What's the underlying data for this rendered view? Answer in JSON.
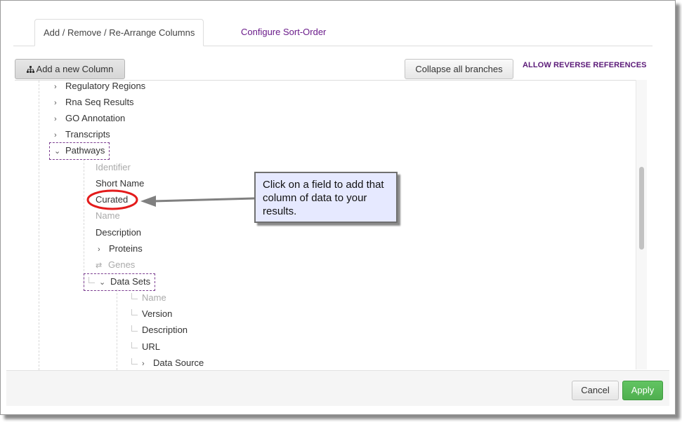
{
  "tabs": [
    {
      "label": "Add / Remove / Re-Arrange Columns",
      "active": true
    },
    {
      "label": "Configure Sort-Order",
      "active": false
    }
  ],
  "toolbar": {
    "add_column_label": "Add a new Column",
    "add_column_icon": "sitemap-icon",
    "collapse_label": "Collapse all branches",
    "reverse_refs_label": "ALLOW REVERSE REFERENCES"
  },
  "tree": {
    "regulatory": "Regulatory Regions",
    "rnaseq": "Rna Seq Results",
    "go": "GO Annotation",
    "transcripts": "Transcripts",
    "pathways": "Pathways",
    "identifier": "Identifier",
    "short_name": "Short Name",
    "curated": "Curated",
    "name": "Name",
    "description": "Description",
    "proteins": "Proteins",
    "genes": "Genes",
    "data_sets": "Data Sets",
    "ds_name": "Name",
    "ds_version": "Version",
    "ds_description": "Description",
    "ds_url": "URL",
    "ds_source": "Data Source"
  },
  "callout": {
    "text": "Click on a field to add that column of data to your results."
  },
  "footer": {
    "cancel_label": "Cancel",
    "apply_label": "Apply"
  },
  "colors": {
    "link_purple": "#6a1b8a",
    "apply_green": "#5cb85c",
    "highlight_red": "#e31b1b",
    "callout_bg": "#e6e9ff"
  }
}
